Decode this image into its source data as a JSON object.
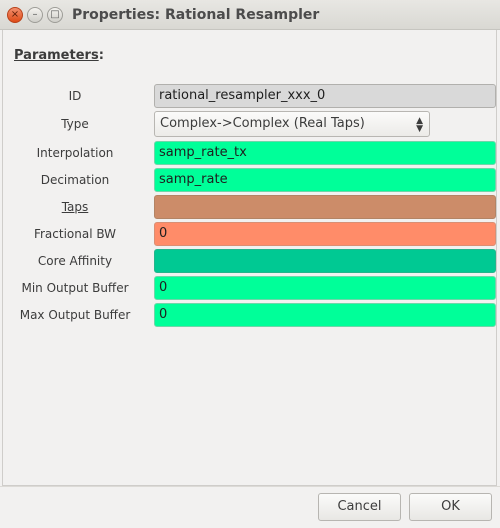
{
  "window": {
    "title": "Properties: Rational Resampler",
    "close_glyph": "×",
    "minimize_glyph": "–",
    "maximize_glyph": "□"
  },
  "section": {
    "title_underlined": "Parameters",
    "title_suffix": ":"
  },
  "params": [
    {
      "label": "ID",
      "value": "rational_resampler_xxx_0",
      "color": "#d9d9d9"
    },
    {
      "label": "Type",
      "value": "Complex->Complex (Real Taps)",
      "kind": "select"
    },
    {
      "label": "Interpolation",
      "value": "samp_rate_tx",
      "color": "#00ff99"
    },
    {
      "label": "Decimation",
      "value": "samp_rate",
      "color": "#00ff99"
    },
    {
      "label": "Taps",
      "value": "",
      "color": "#cc8c69"
    },
    {
      "label": "Fractional BW",
      "value": "0",
      "color": "#ff8c69"
    },
    {
      "label": "Core Affinity",
      "value": "",
      "color": "#00c993"
    },
    {
      "label": "Min Output Buffer",
      "value": "0",
      "color": "#00ff99"
    },
    {
      "label": "Max Output Buffer",
      "value": "0",
      "color": "#00ff99"
    }
  ],
  "buttons": {
    "cancel": "Cancel",
    "ok": "OK"
  }
}
